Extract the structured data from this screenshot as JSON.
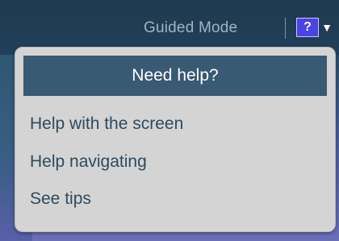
{
  "header": {
    "mode_label": "Guided Mode",
    "help_symbol": "?",
    "dropdown_symbol": "▼"
  },
  "help_menu": {
    "title": "Need help?",
    "items": [
      "Help with the screen",
      "Help navigating",
      "See tips"
    ]
  },
  "colors": {
    "header_bg": "#1e3a4f",
    "menu_bg": "#d4d4d4",
    "menu_header_bg": "#385a72",
    "menu_text": "#2f4a5e",
    "help_button_bg": "#4a43e6"
  },
  "icons": {
    "help": "question-mark-icon",
    "dropdown": "chevron-down-icon"
  }
}
